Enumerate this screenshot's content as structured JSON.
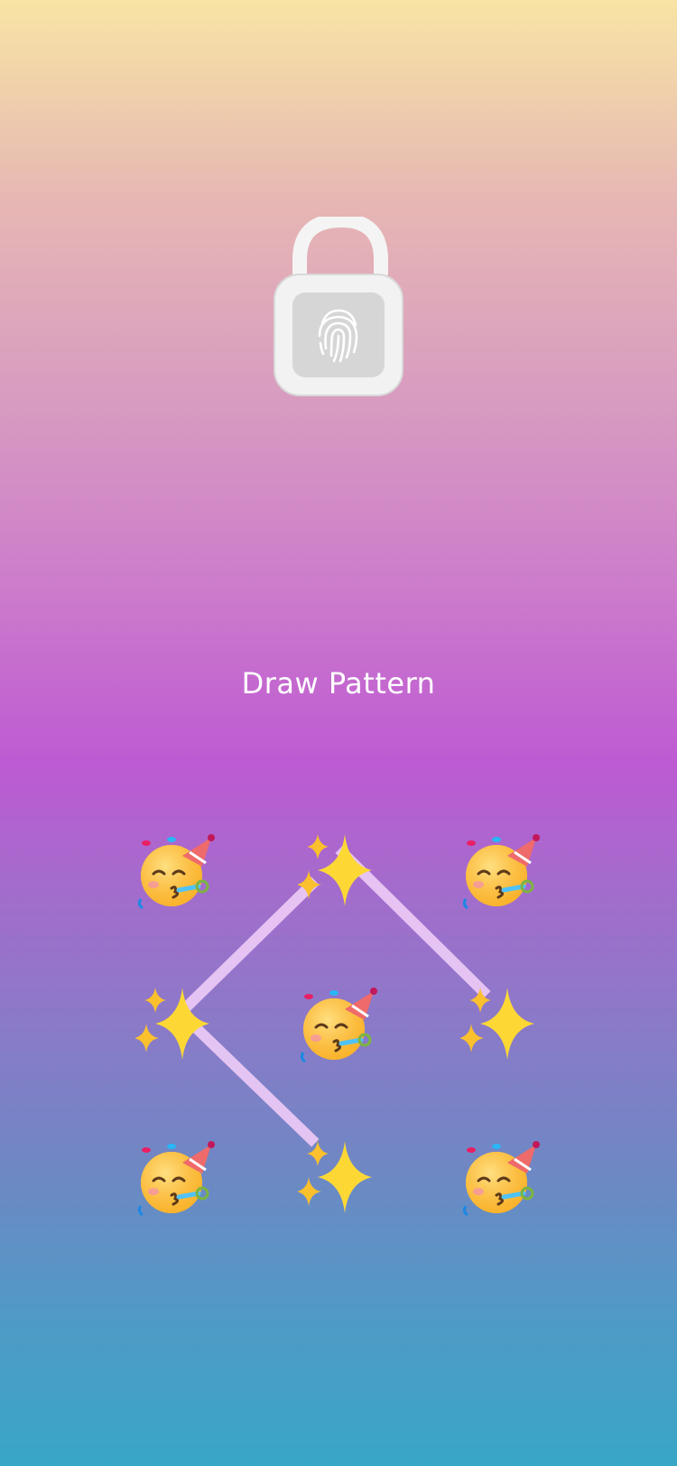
{
  "lock": {
    "icon": "unlocked-padlock-fingerprint-icon"
  },
  "prompt": {
    "title": "Draw Pattern"
  },
  "pattern": {
    "nodes": [
      {
        "icon": "party-face-icon",
        "selected": false
      },
      {
        "icon": "sparkles-icon",
        "selected": true
      },
      {
        "icon": "party-face-icon",
        "selected": false
      },
      {
        "icon": "sparkles-icon",
        "selected": true
      },
      {
        "icon": "party-face-icon",
        "selected": false
      },
      {
        "icon": "sparkles-icon",
        "selected": true
      },
      {
        "icon": "party-face-icon",
        "selected": false
      },
      {
        "icon": "sparkles-icon",
        "selected": true
      },
      {
        "icon": "party-face-icon",
        "selected": false
      }
    ],
    "drawn_sequence": [
      8,
      4,
      2,
      6
    ]
  },
  "colors": {
    "line": "#eac8f6",
    "text": "#ffffff"
  }
}
